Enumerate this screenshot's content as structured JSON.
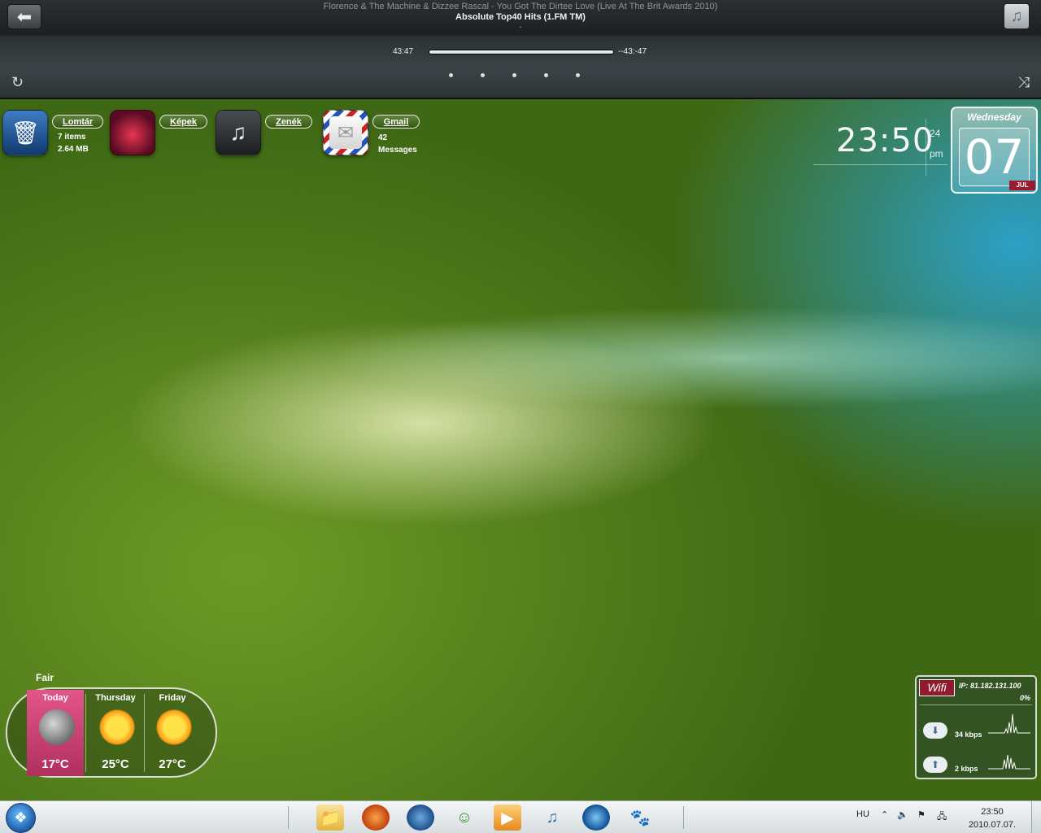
{
  "player": {
    "artist_title": "Florence & The Machine & Dizzee Rascal - You Got The Dirtee Love (Live At The Brit Awards 2010)",
    "station": "Absolute Top40 Hits (1.FM TM)",
    "extra": "-",
    "elapsed": "43:47",
    "remaining": "--43:-47",
    "progress_fraction": 1.0,
    "back_icon": "back-arrow-icon",
    "itunes_icon": "music-note-icon",
    "repeat_icon": "repeat-icon",
    "shuffle_icon": "shuffle-icon",
    "page_dots": 5
  },
  "launchers": [
    {
      "label": "Lomtár",
      "line1": "7 items",
      "line2": "2.64 MB",
      "icon": "trash-icon"
    },
    {
      "label": "Képek",
      "line1": "",
      "line2": "",
      "icon": "pictures-icon"
    },
    {
      "label": "Zenék",
      "line1": "",
      "line2": "",
      "icon": "music-icon"
    },
    {
      "label": "Gmail",
      "line1": "42",
      "line2": "Messages",
      "icon": "mail-icon"
    }
  ],
  "clock": {
    "time": "23:50",
    "seconds": "24",
    "ampm": "pm",
    "weekday": "Wednesday",
    "day": "07",
    "month": "JUL"
  },
  "weather": {
    "condition": "Fair",
    "days": [
      {
        "name": "Today",
        "temp": "17°C",
        "icon": "moon-cloud-icon"
      },
      {
        "name": "Thursday",
        "temp": "25°C",
        "icon": "sun-icon"
      },
      {
        "name": "Friday",
        "temp": "27°C",
        "icon": "sun-icon"
      }
    ]
  },
  "wifi": {
    "logo": "Wifi",
    "ip": "IP: 81.182.131.100",
    "percent": "0%",
    "download": "34 kbps",
    "upload": "2 kbps"
  },
  "taskbar": {
    "apps": [
      "file-explorer-icon",
      "firefox-icon",
      "thunderbird-icon",
      "messenger-icon",
      "media-player-icon",
      "itunes-icon",
      "google-earth-icon",
      "gimp-icon"
    ],
    "language": "HU",
    "time": "23:50",
    "date": "2010.07.07."
  },
  "colors": {
    "accent_red": "#9b1b2f",
    "today_pink": "#d2487b",
    "topbar": "#2b3032"
  }
}
